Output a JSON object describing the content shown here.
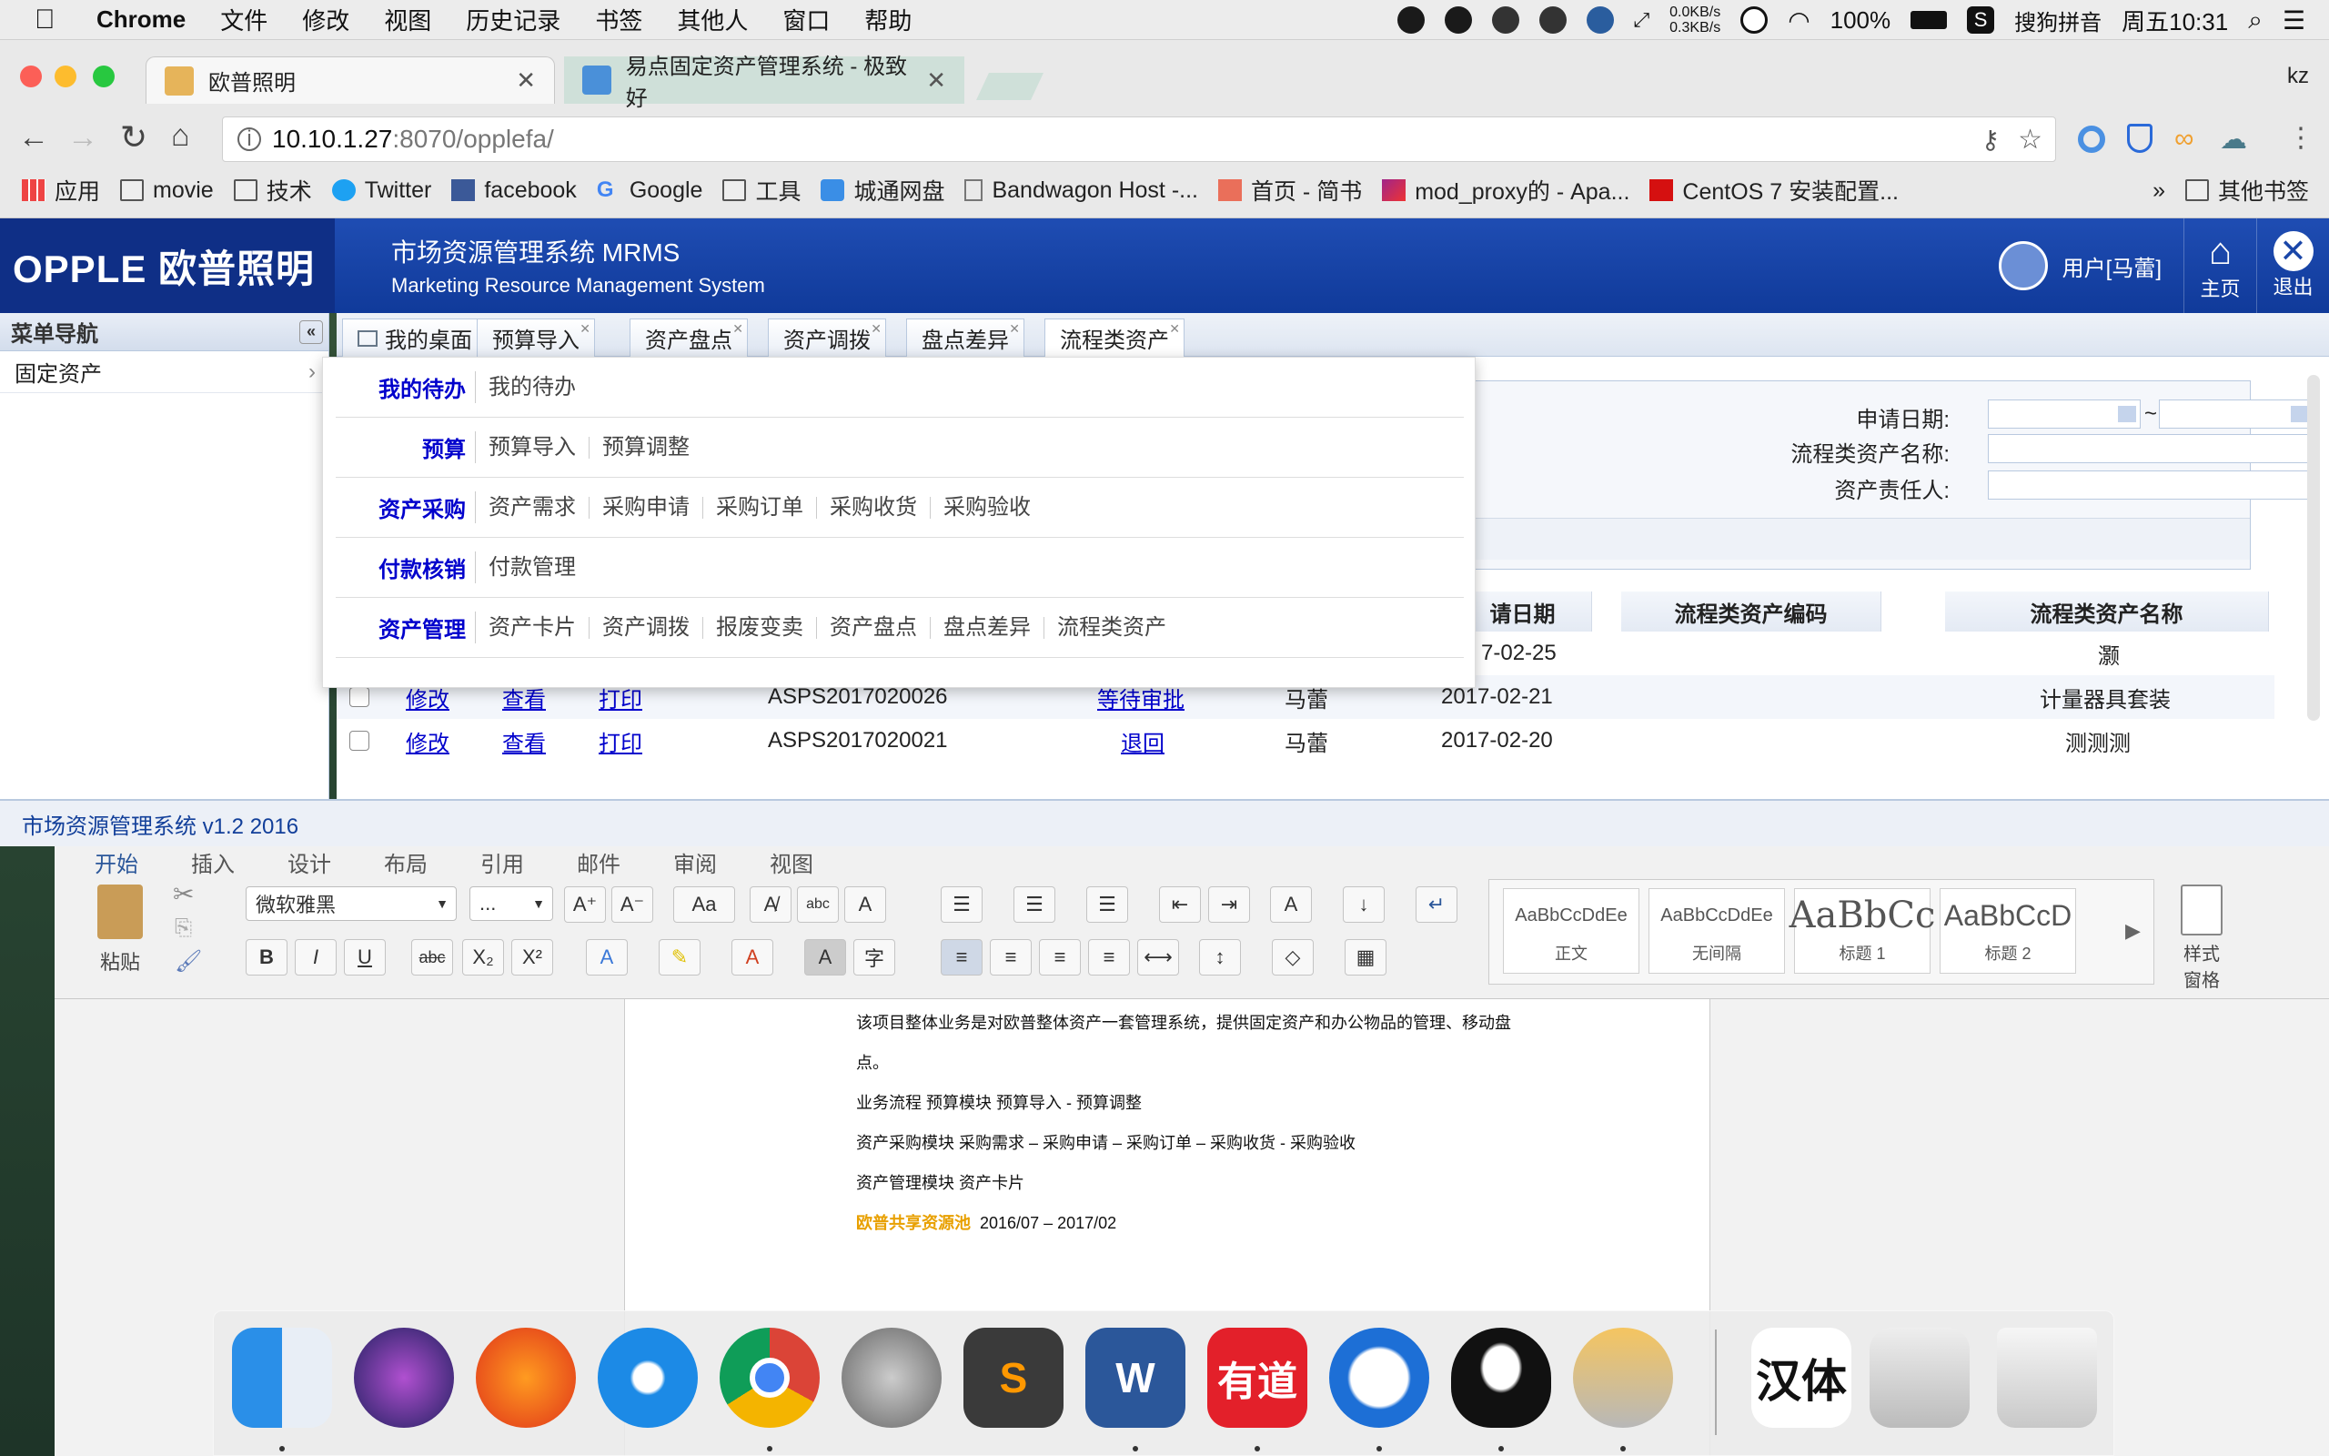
{
  "menubar": {
    "app": "Chrome",
    "items": [
      "文件",
      "修改",
      "视图",
      "历史记录",
      "书签",
      "其他人",
      "窗口",
      "帮助"
    ],
    "net_up": "0.0KB/s",
    "net_down": "0.3KB/s",
    "battery": "100%",
    "ime": "搜狗拼音",
    "clock": "周五10:31"
  },
  "chrome": {
    "tab1": "欧普照明",
    "tab2": "易点固定资产管理系统 - 极致好",
    "user": "kz",
    "url_host": "10.10.1.27",
    "url_rest": ":8070/opplefa/"
  },
  "bookmarks": {
    "items": [
      "应用",
      "movie",
      "技术",
      "Twitter",
      "facebook",
      "Google",
      "工具",
      "城通网盘",
      "Bandwagon Host -...",
      "首页 - 简书",
      "mod_proxy的 - Apa...",
      "CentOS 7 安装配置..."
    ],
    "more": "»",
    "other": "其他书签"
  },
  "app": {
    "logo": "OPPLE 欧普照明",
    "sys_cn": "市场资源管理系统 MRMS",
    "sys_en": "Marketing Resource Management System",
    "user": "用户[马蕾]",
    "home": "主页",
    "logout": "退出",
    "nav_title": "菜单导航",
    "nav_item": "固定资产",
    "collapse": "«",
    "tabs": [
      "我的桌面",
      "预算导入",
      "资产盘点",
      "资产调拨",
      "盘点差异",
      "流程类资产"
    ],
    "form": {
      "date_label": "申请日期:",
      "tilde": "~",
      "name_label": "流程类资产名称:",
      "owner_label": "资产责任人:"
    },
    "grid_headers": [
      "请日期",
      "流程类资产编码",
      "流程类资产名称"
    ],
    "rows": [
      {
        "date": "7-02-25",
        "name": "灏"
      },
      {
        "edit": "修改",
        "view": "查看",
        "print": "打印",
        "code": "ASPS2017020026",
        "status": "等待审批",
        "person": "马蕾",
        "date": "2017-02-21",
        "name": "计量器具套装"
      },
      {
        "edit": "修改",
        "view": "查看",
        "print": "打印",
        "code": "ASPS2017020021",
        "status": "退回",
        "person": "马蕾",
        "date": "2017-02-20",
        "name": "测测测"
      }
    ],
    "footer": "市场资源管理系统 v1.2   2016"
  },
  "dropdown": [
    {
      "cat": "我的待办",
      "items": [
        "我的待办"
      ]
    },
    {
      "cat": "预算",
      "items": [
        "预算导入",
        "预算调整"
      ]
    },
    {
      "cat": "资产采购",
      "items": [
        "资产需求",
        "采购申请",
        "采购订单",
        "采购收货",
        "采购验收"
      ]
    },
    {
      "cat": "付款核销",
      "items": [
        "付款管理"
      ]
    },
    {
      "cat": "资产管理",
      "items": [
        "资产卡片",
        "资产调拨",
        "报废变卖",
        "资产盘点",
        "盘点差异",
        "流程类资产"
      ]
    }
  ],
  "word": {
    "tabs": [
      "开始",
      "插入",
      "设计",
      "布局",
      "引用",
      "邮件",
      "审阅",
      "视图"
    ],
    "paste": "粘贴",
    "font": "微软雅黑",
    "size": "...",
    "styles": [
      {
        "sample": "AaBbCcDdEe",
        "name": "正文"
      },
      {
        "sample": "AaBbCcDdEe",
        "name": "无间隔"
      },
      {
        "sample": "AaBbCc",
        "name": "标题 1"
      },
      {
        "sample": "AaBbCcD",
        "name": "标题 2"
      }
    ],
    "style_pane": "样式\n窗格",
    "lines": [
      "该项目整体业务是对欧普整体资产一套管理系统，提供固定资产和办公物品的管理、移动盘",
      "点。",
      "业务流程  预算模块  预算导入 - 预算调整",
      "资产采购模块  采购需求 – 采购申请 – 采购订单 – 采购收货 - 采购验收",
      "资产管理模块  资产卡片"
    ],
    "highlight": "欧普共享资源池",
    "highlight_rest": "2016/07 – 2017/02"
  },
  "dock": {
    "youdao": "有道",
    "hanti": "汉体"
  }
}
